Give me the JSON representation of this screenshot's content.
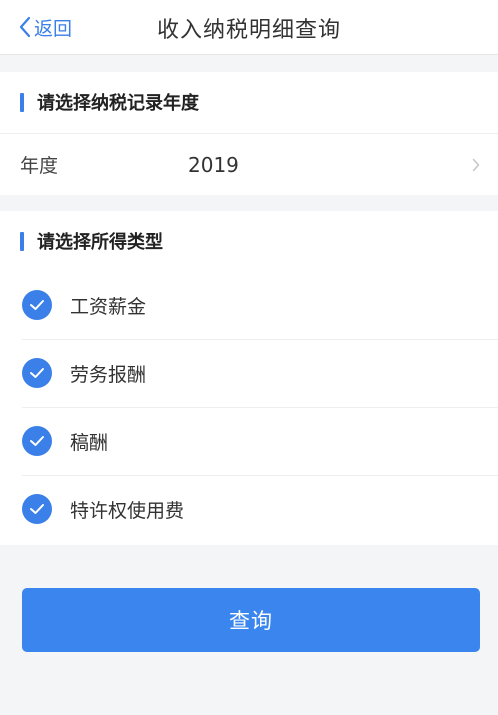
{
  "header": {
    "back_label": "返回",
    "title": "收入纳税明细查询"
  },
  "year_section": {
    "title": "请选择纳税记录年度",
    "field_label": "年度",
    "value": "2019"
  },
  "type_section": {
    "title": "请选择所得类型",
    "options": [
      {
        "label": "工资薪金",
        "checked": true
      },
      {
        "label": "劳务报酬",
        "checked": true
      },
      {
        "label": "稿酬",
        "checked": true
      },
      {
        "label": "特许权使用费",
        "checked": true
      }
    ]
  },
  "submit_label": "查询",
  "colors": {
    "accent": "#3a80e8",
    "button": "#3a86ee",
    "background": "#f4f5f7"
  }
}
